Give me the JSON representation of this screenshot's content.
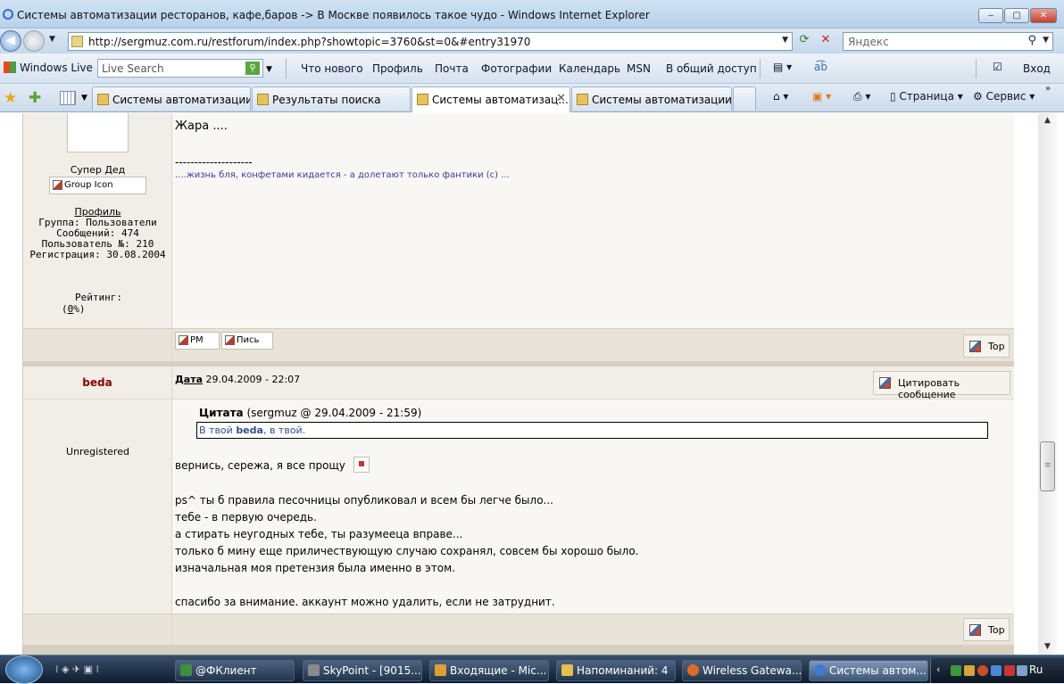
{
  "window": {
    "title": "Системы автоматизации ресторанов, кафе,баров -> В Москве появилось такое чудо - Windows Internet Explorer",
    "min": "‒",
    "max": "▢",
    "close": "✕"
  },
  "address": {
    "url": "http://sergmuz.com.ru/restforum/index.php?showtopic=3760&st=0&#entry31970",
    "search_placeholder": "Яндекс"
  },
  "toolbar": {
    "windows_live": "Windows Live",
    "live_search_placeholder": "Live Search",
    "links": [
      "Что нового",
      "Профиль",
      "Почта",
      "Фотографии",
      "Календарь",
      "MSN",
      "В общий доступ"
    ],
    "signin": "Вход"
  },
  "tabs": [
    {
      "label": "Системы автоматизации ..."
    },
    {
      "label": "Результаты поиска"
    },
    {
      "label": "Системы автоматизац..."
    },
    {
      "label": "Системы автоматизации ..."
    }
  ],
  "commandbar": {
    "page": "Страница",
    "tools": "Сервис"
  },
  "post1": {
    "body": "Жара ....",
    "sig_line": "--------------------",
    "sig_text": "....жизнь бля, конфетами кидается - а долетают только фантики (с) ...",
    "rank": "Супер Дед",
    "group_icon": "Group Icon",
    "profile": "Профиль",
    "group": "Группа: Пользователи",
    "messages": "Сообщений: 474",
    "user_no": "Пользователь №: 210",
    "registered": "Регистрация: 30.08.2004",
    "rating_label": "Рейтинг:",
    "rating_value_prefix": "(",
    "rating_value_u": "0",
    "rating_value_suffix": "%)",
    "btn_pm": "PM",
    "btn_mail": "Пись",
    "top": "Top"
  },
  "post2": {
    "author": "beda",
    "date_label": "Дата",
    "date": "29.04.2009 - 22:07",
    "quote_button": "Цитировать сообщение",
    "status": "Unregistered",
    "quote_head_bold": "Цитата",
    "quote_head_rest": "(sergmuz @ 29.04.2009 - 21:59)",
    "quote_pre": "В твой ",
    "quote_bold": "beda",
    "quote_post": ", в твой.",
    "line1": "вернись, сережа, я все прощу",
    "line2": "ps^ ты б правила песочницы опубликовал и всем бы легче было...",
    "line3": "тебе - в первую очередь.",
    "line4": "а стирать неугодных тебе, ты разумееца вправе...",
    "line5": "только б мину еще приличествующую случаю сохранял, совсем бы хорошо было.",
    "line6": "изначальная моя претензия была именно в этом.",
    "line7": "спасибо за внимание. аккаунт можно удалить, если не затруднит.",
    "top": "Top"
  },
  "taskbar": {
    "items": [
      {
        "label": "@ФКлиент",
        "color": "#3f8f3f"
      },
      {
        "label": "SkyPoint - [9015...",
        "color": "#8a8a8a"
      },
      {
        "label": "Входящие - Mic...",
        "color": "#e0a030"
      },
      {
        "label": "Напоминаний: 4",
        "color": "#e6c04a"
      },
      {
        "label": "Wireless Gatewa...",
        "color": "#e06b20"
      },
      {
        "label": "Системы автом...",
        "color": "#3b7bd4"
      }
    ],
    "lang": "Ru"
  },
  "colors": {
    "author": "#8b0000",
    "signature": "#3b3b9b",
    "quote_text": "#2f4f8f"
  }
}
